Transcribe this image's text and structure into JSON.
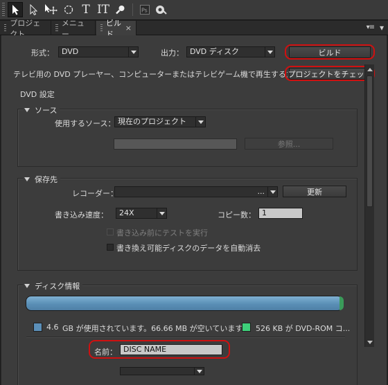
{
  "toolbar": {
    "icons": [
      "selection-arrow-icon",
      "direct-selection-icon",
      "move-icon",
      "rotate-icon",
      "text-icon",
      "vertical-text-icon",
      "zoom-icon",
      "photoshop-icon",
      "paint-bucket-icon"
    ]
  },
  "tabs": [
    {
      "label": "プロジェクト"
    },
    {
      "label": "メニュー"
    },
    {
      "label": "ビルド",
      "close": "×"
    }
  ],
  "panel_menu": "▾≡",
  "panel_close": "▾",
  "top": {
    "format_label": "形式：",
    "format_value": "DVD",
    "output_label": "出力：",
    "output_value": "DVD ディスク",
    "build_button": "ビルド",
    "description": "テレビ用の DVD プレーヤー、コンピューターまたはテレビゲーム機で再生するための...",
    "check_project_button": "プロジェクトをチェック"
  },
  "dvd_settings": {
    "heading": "DVD 設定",
    "source": {
      "title": "ソース",
      "use_source_label": "使用するソース：",
      "use_source_value": "現在のプロジェクト",
      "browse_button": "参照..."
    },
    "destination": {
      "title": "保存先",
      "recorder_label": "レコーダー：",
      "recorder_value": "...",
      "refresh_button": "更新",
      "write_speed_label": "書き込み速度：",
      "write_speed_value": "24X",
      "copies_label": "コピー数：",
      "copies_value": "1",
      "test_before_write_label": "書き込み前にテストを実行",
      "auto_erase_label": "書き換え可能ディスクのデータを自動消去"
    },
    "disc_info": {
      "title": "ディスク情報",
      "used_amount": "4.6",
      "used_text": "GB が使用されています。66.66 MB が空いています。",
      "dvdrom_text": "526 KB が DVD-ROM コ...",
      "used_color": "#5b8fb8",
      "dvdrom_color": "#3ed07a",
      "name_label": "名前：",
      "name_value": "DISC NAME"
    }
  },
  "colors": {
    "highlight_ring": "#d01010",
    "panel_bg": "#3c3c3c"
  }
}
